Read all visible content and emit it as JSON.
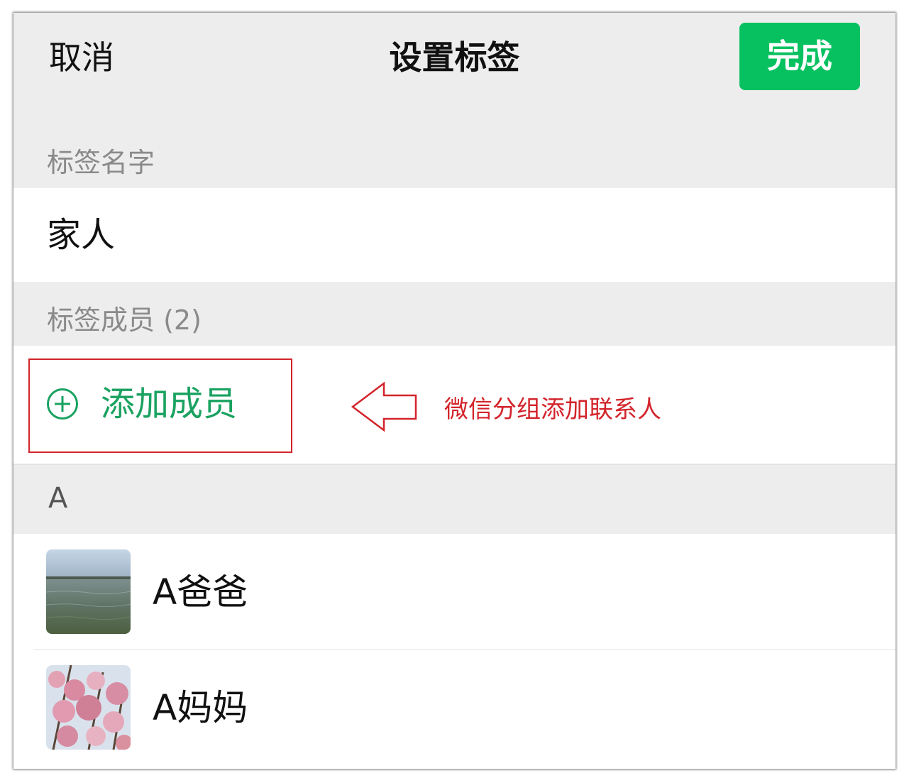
{
  "navbar": {
    "cancel_label": "取消",
    "title": "设置标签",
    "done_label": "完成"
  },
  "tag_name_section": {
    "label": "标签名字",
    "value": "家人"
  },
  "members_section": {
    "label": "标签成员 (2)",
    "add_member_label": "添加成员"
  },
  "annotation": {
    "text": "微信分组添加联系人",
    "color": "#d3242b"
  },
  "contacts": {
    "index_letter": "A",
    "items": [
      {
        "name": "A爸爸",
        "avatar": "lake-photo"
      },
      {
        "name": "A妈妈",
        "avatar": "blossom-photo"
      }
    ]
  },
  "colors": {
    "accent_green": "#07c160",
    "add_text_green": "#1aa261",
    "background": "#ededed"
  }
}
